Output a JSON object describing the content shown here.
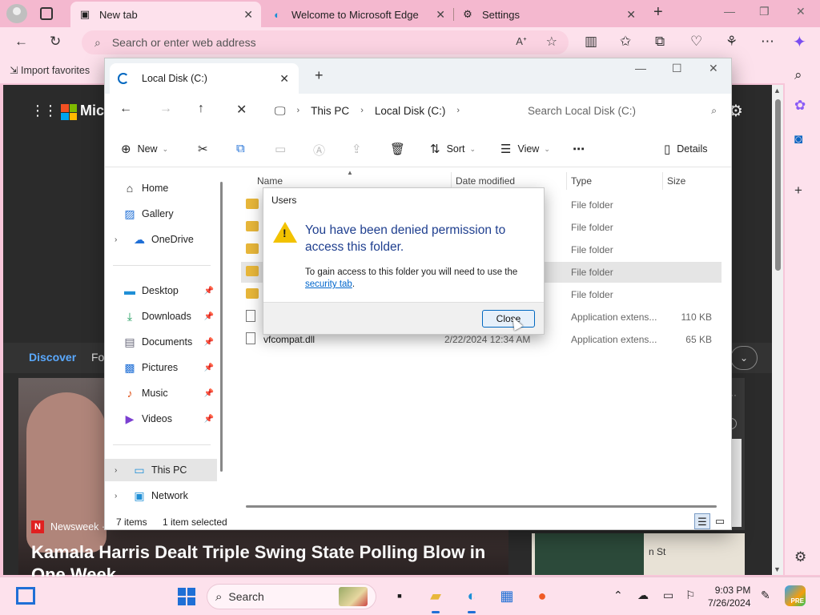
{
  "browser": {
    "tabs": [
      {
        "label": "New tab",
        "icon": "new-tab-icon",
        "active": true
      },
      {
        "label": "Welcome to Microsoft Edge",
        "icon": "edge-icon",
        "active": false
      },
      {
        "label": "Settings",
        "icon": "gear-icon",
        "active": false
      }
    ],
    "address_placeholder": "Search or enter web address",
    "favorites_import": "Import favorites"
  },
  "newtab": {
    "brand": "Micr",
    "discover_tabs": [
      "Discover",
      "Fo"
    ],
    "news_source": "Newsweek ·",
    "headline": "Kamala Harris Dealt Triple Swing State Polling Blow in One Week",
    "map_label": "n St"
  },
  "explorer": {
    "tab_title": "Local Disk (C:)",
    "breadcrumb": [
      "This PC",
      "Local Disk (C:)"
    ],
    "search_placeholder": "Search Local Disk (C:)",
    "commands": {
      "new": "New",
      "sort": "Sort",
      "view": "View",
      "details": "Details"
    },
    "nav_pane": {
      "top": [
        {
          "label": "Home",
          "icon": "home-icon"
        },
        {
          "label": "Gallery",
          "icon": "gallery-icon"
        },
        {
          "label": "OneDrive",
          "icon": "cloud-icon"
        }
      ],
      "quick_access": [
        {
          "label": "Desktop",
          "icon": "desktop-icon"
        },
        {
          "label": "Downloads",
          "icon": "download-icon"
        },
        {
          "label": "Documents",
          "icon": "documents-icon"
        },
        {
          "label": "Pictures",
          "icon": "pictures-icon"
        },
        {
          "label": "Music",
          "icon": "music-icon"
        },
        {
          "label": "Videos",
          "icon": "videos-icon"
        }
      ],
      "bottom": [
        {
          "label": "This PC",
          "icon": "pc-icon"
        },
        {
          "label": "Network",
          "icon": "network-icon"
        }
      ]
    },
    "columns": [
      "Name",
      "Date modified",
      "Type",
      "Size"
    ],
    "rows": [
      {
        "name": "",
        "date": "",
        "type": "File folder",
        "size": "",
        "kind": "folder"
      },
      {
        "name": "",
        "date": "",
        "type": "File folder",
        "size": "",
        "kind": "folder"
      },
      {
        "name": "",
        "date": "",
        "type": "File folder",
        "size": "",
        "kind": "folder"
      },
      {
        "name": "",
        "date": "",
        "type": "File folder",
        "size": "",
        "kind": "folder"
      },
      {
        "name": "",
        "date": "",
        "type": "File folder",
        "size": "",
        "kind": "folder"
      },
      {
        "name": "",
        "date": "",
        "type": "Application extens...",
        "size": "110 KB",
        "kind": "file"
      },
      {
        "name": "vfcompat.dll",
        "date": "2/22/2024 12:34 AM",
        "type": "Application extens...",
        "size": "65 KB",
        "kind": "file"
      }
    ],
    "status_items": "7 items",
    "status_selected": "1 item selected"
  },
  "dialog": {
    "title": "Users",
    "message": "You have been denied permission to access this folder.",
    "detail_prefix": "To gain access to this folder you will need to use the",
    "detail_link": "security tab",
    "detail_suffix": ".",
    "close_label": "Close"
  },
  "taskbar": {
    "search_label": "Search",
    "time": "9:03 PM",
    "date": "7/26/2024",
    "badge": "PRE"
  },
  "colors": {
    "accent": "#0067c0",
    "edge_tint": "#fde1ec",
    "warning": "#f2c200",
    "folder": "#e8b73a"
  }
}
